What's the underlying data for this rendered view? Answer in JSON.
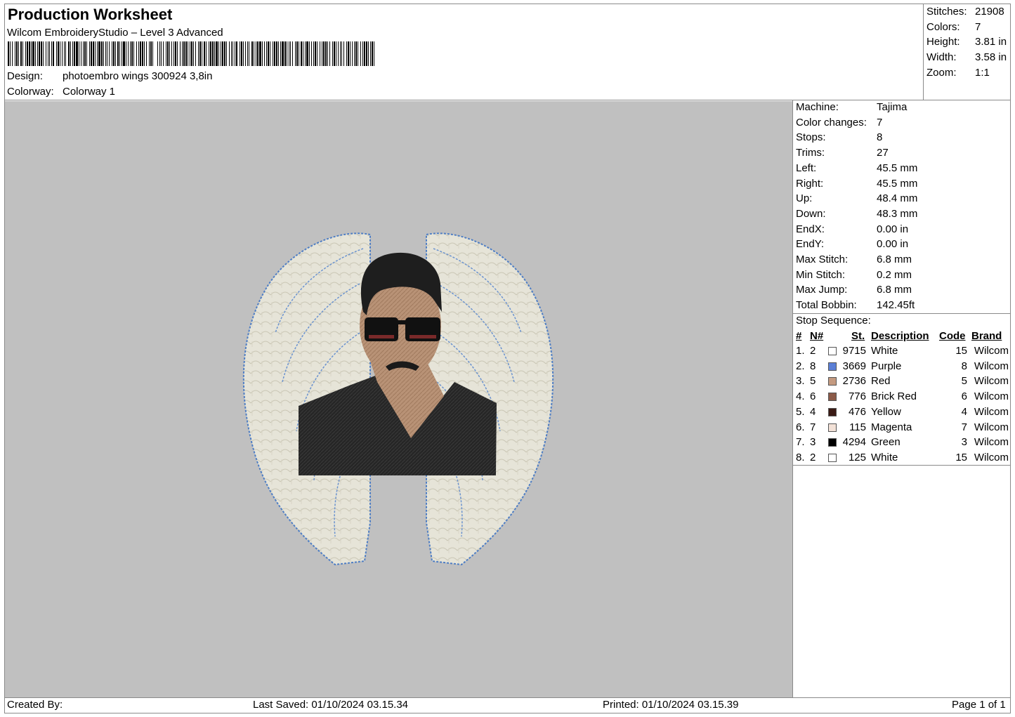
{
  "header": {
    "title": "Production Worksheet",
    "subtitle": "Wilcom EmbroideryStudio – Level 3 Advanced",
    "design_label": "Design:",
    "design_value": "photoembro wings 300924 3,8in",
    "colorway_label": "Colorway:",
    "colorway_value": "Colorway 1"
  },
  "stats": [
    {
      "label": "Stitches:",
      "value": "21908"
    },
    {
      "label": "Colors:",
      "value": "7"
    },
    {
      "label": "Height:",
      "value": "3.81 in"
    },
    {
      "label": "Width:",
      "value": "3.58 in"
    },
    {
      "label": "Zoom:",
      "value": "1:1"
    }
  ],
  "machine_info": [
    {
      "label": "Machine:",
      "value": "Tajima"
    },
    {
      "label": "Color changes:",
      "value": "7"
    },
    {
      "label": "Stops:",
      "value": "8"
    },
    {
      "label": "Trims:",
      "value": "27"
    },
    {
      "label": "Left:",
      "value": "45.5 mm"
    },
    {
      "label": "Right:",
      "value": "45.5 mm"
    },
    {
      "label": "Up:",
      "value": "48.4 mm"
    },
    {
      "label": "Down:",
      "value": "48.3 mm"
    },
    {
      "label": "EndX:",
      "value": "0.00 in"
    },
    {
      "label": "EndY:",
      "value": "0.00 in"
    },
    {
      "label": "Max Stitch:",
      "value": "6.8 mm"
    },
    {
      "label": "Min Stitch:",
      "value": "0.2 mm"
    },
    {
      "label": "Max Jump:",
      "value": "6.8 mm"
    },
    {
      "label": "Total Bobbin:",
      "value": "142.45ft"
    }
  ],
  "stop_sequence": {
    "title": "Stop Sequence:",
    "columns": {
      "idx": "#",
      "n": "N#",
      "st": "St.",
      "desc": "Description",
      "code": "Code",
      "brand": "Brand"
    },
    "rows": [
      {
        "idx": "1.",
        "n": "2",
        "color": "#ffffff",
        "st": "9715",
        "desc": "White",
        "code": "15",
        "brand": "Wilcom"
      },
      {
        "idx": "2.",
        "n": "8",
        "color": "#5b7fd6",
        "st": "3669",
        "desc": "Purple",
        "code": "8",
        "brand": "Wilcom"
      },
      {
        "idx": "3.",
        "n": "5",
        "color": "#c49a80",
        "st": "2736",
        "desc": "Red",
        "code": "5",
        "brand": "Wilcom"
      },
      {
        "idx": "4.",
        "n": "6",
        "color": "#8b5a48",
        "st": "776",
        "desc": "Brick Red",
        "code": "6",
        "brand": "Wilcom"
      },
      {
        "idx": "5.",
        "n": "4",
        "color": "#3a1a14",
        "st": "476",
        "desc": "Yellow",
        "code": "4",
        "brand": "Wilcom"
      },
      {
        "idx": "6.",
        "n": "7",
        "color": "#f3e2d8",
        "st": "115",
        "desc": "Magenta",
        "code": "7",
        "brand": "Wilcom"
      },
      {
        "idx": "7.",
        "n": "3",
        "color": "#000000",
        "st": "4294",
        "desc": "Green",
        "code": "3",
        "brand": "Wilcom"
      },
      {
        "idx": "8.",
        "n": "2",
        "color": "#ffffff",
        "st": "125",
        "desc": "White",
        "code": "15",
        "brand": "Wilcom"
      }
    ]
  },
  "footer": {
    "created_by": "Created By:",
    "last_saved": "Last Saved: 01/10/2024 03.15.34",
    "printed": "Printed: 01/10/2024 03.15.39",
    "page": "Page 1 of 1"
  },
  "colors": {
    "canvas_bg": "#c0c0c0",
    "border": "#8a8a8a"
  }
}
